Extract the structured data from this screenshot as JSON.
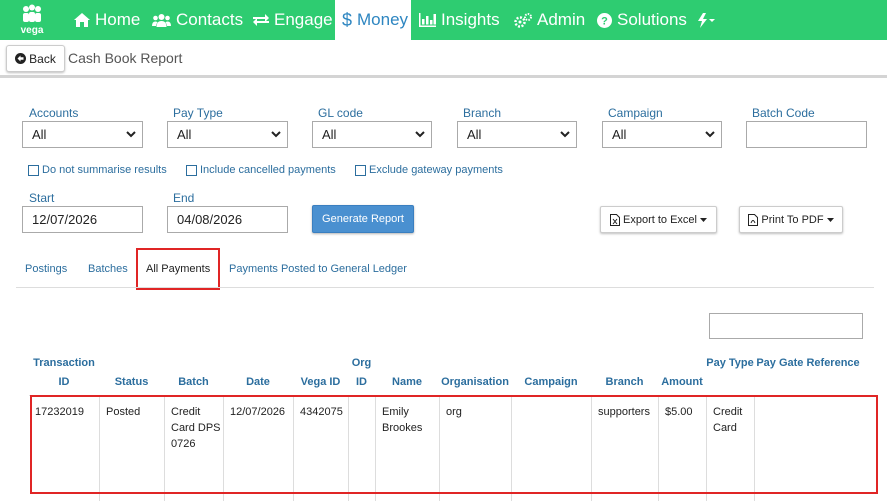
{
  "brand": {
    "logo_text": "vega",
    "nav_bg": "#2ecc71",
    "accent": "#2e86c1",
    "highlight": "#e02525"
  },
  "nav": {
    "items": [
      {
        "label": "Home",
        "icon": "home-icon"
      },
      {
        "label": "Contacts",
        "icon": "users-icon"
      },
      {
        "label": "Engage",
        "icon": "exchange-icon"
      },
      {
        "label": "Money",
        "icon": "dollar-icon",
        "active": true
      },
      {
        "label": "Insights",
        "icon": "bar-chart-icon"
      },
      {
        "label": "Admin",
        "icon": "gears-icon"
      },
      {
        "label": "Solutions",
        "icon": "question-circle-icon"
      }
    ],
    "extra_icon": "bolt-dropdown-icon"
  },
  "subbar": {
    "back_label": "Back",
    "page_title": "Cash Book Report"
  },
  "filters": {
    "accounts": {
      "label": "Accounts",
      "value": "All"
    },
    "pay_type": {
      "label": "Pay Type",
      "value": "All"
    },
    "gl_code": {
      "label": "GL code",
      "value": "All"
    },
    "branch": {
      "label": "Branch",
      "value": "All"
    },
    "campaign": {
      "label": "Campaign",
      "value": "All"
    },
    "batch_code": {
      "label": "Batch Code",
      "value": ""
    },
    "start": {
      "label": "Start",
      "value": "12/07/2026"
    },
    "end": {
      "label": "End",
      "value": "04/08/2026"
    }
  },
  "checkboxes": [
    {
      "label": "Do not summarise results",
      "checked": false
    },
    {
      "label": "Include cancelled payments",
      "checked": false
    },
    {
      "label": "Exclude gateway payments",
      "checked": false
    }
  ],
  "buttons": {
    "generate": "Generate Report",
    "export": "Export to Excel",
    "print": "Print To PDF"
  },
  "tabs": [
    {
      "label": "Postings"
    },
    {
      "label": "Batches"
    },
    {
      "label": "All Payments",
      "active": true
    },
    {
      "label": "Payments Posted to General Ledger"
    }
  ],
  "table": {
    "headers": [
      "Transaction ID",
      "Status",
      "Batch",
      "Date",
      "Vega ID",
      "Org ID",
      "Name",
      "Organisation",
      "Campaign",
      "Branch",
      "Amount",
      "Pay Type",
      "Pay Gate Reference"
    ],
    "rows": [
      [
        "17232019",
        "Posted",
        "Credit Card DPS 0726",
        "12/07/2026",
        "4342075",
        "",
        "Emily Brookes",
        "org",
        "",
        "supporters",
        "$5.00",
        "Credit Card",
        ""
      ]
    ]
  }
}
